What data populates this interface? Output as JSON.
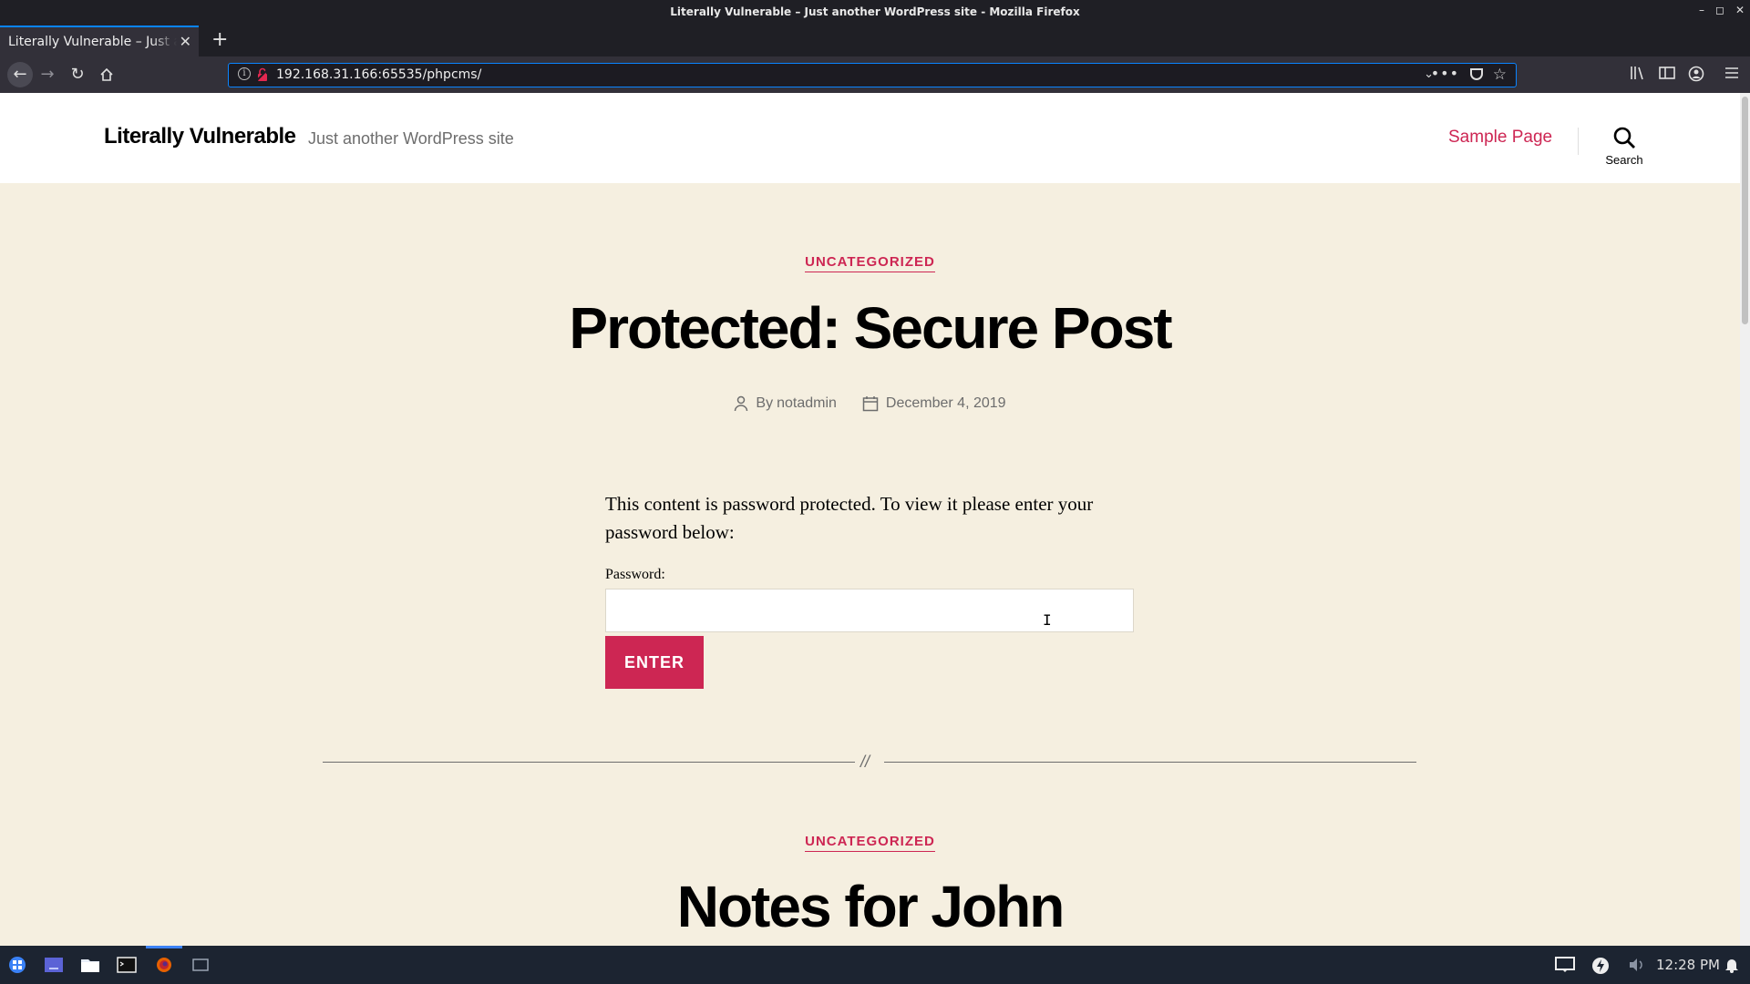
{
  "window": {
    "title": "Literally Vulnerable – Just another WordPress site - Mozilla Firefox"
  },
  "tabs": [
    {
      "title": "Literally Vulnerable – Just another WordPress site"
    }
  ],
  "urlbar": {
    "url": "192.168.31.166:65535/phpcms/"
  },
  "site": {
    "title": "Literally Vulnerable",
    "description": "Just another WordPress site",
    "nav_items": [
      "Sample Page"
    ],
    "search_label": "Search"
  },
  "posts": [
    {
      "category": "UNCATEGORIZED",
      "title": "Protected: Secure Post",
      "author_prefix": "By",
      "author": "notadmin",
      "date": "December 4, 2019",
      "protected_message": "This content is password protected. To view it please enter your password below:",
      "password_label": "Password:",
      "password_value": "",
      "submit_label": "ENTER"
    },
    {
      "category": "UNCATEGORIZED",
      "title": "Notes for John"
    }
  ],
  "divider_mark": "//",
  "taskbar": {
    "clock": "12:28 PM"
  }
}
